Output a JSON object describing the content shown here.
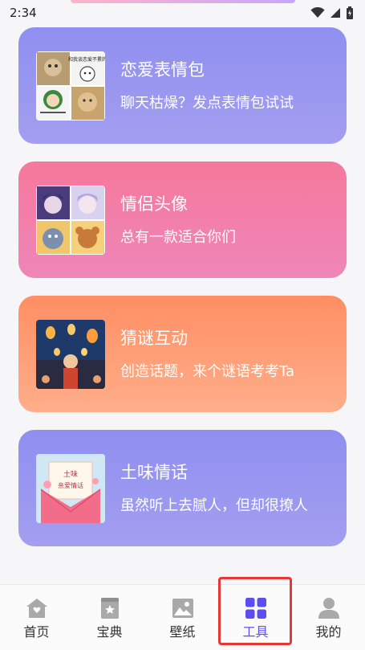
{
  "status_bar": {
    "time": "2:34"
  },
  "cards": [
    {
      "title": "恋爱表情包",
      "subtitle": "聊天枯燥？发点表情包试试",
      "thumb": "meme-collage"
    },
    {
      "title": "情侣头像",
      "subtitle": "总有一款适合你们",
      "thumb": "couple-avatars"
    },
    {
      "title": "猜谜互动",
      "subtitle": "创造话题，来个谜语考考Ta",
      "thumb": "lanterns"
    },
    {
      "title": "土味情话",
      "subtitle": "虽然听上去腻人，但却很撩人",
      "thumb": "love-letter"
    }
  ],
  "thumb_text": {
    "meme_top_right": "和我谈恋爱不累的",
    "letter_title": "土味",
    "letter_sub": "亲爱情话"
  },
  "bottom_nav": {
    "items": [
      {
        "label": "首页",
        "icon": "home-icon",
        "active": false
      },
      {
        "label": "宝典",
        "icon": "book-icon",
        "active": false
      },
      {
        "label": "壁纸",
        "icon": "image-icon",
        "active": false
      },
      {
        "label": "工具",
        "icon": "grid-icon",
        "active": true
      },
      {
        "label": "我的",
        "icon": "person-icon",
        "active": false
      }
    ]
  },
  "colors": {
    "active": "#5b4ef0",
    "inactive": "#333333",
    "highlight": "#e53935"
  }
}
